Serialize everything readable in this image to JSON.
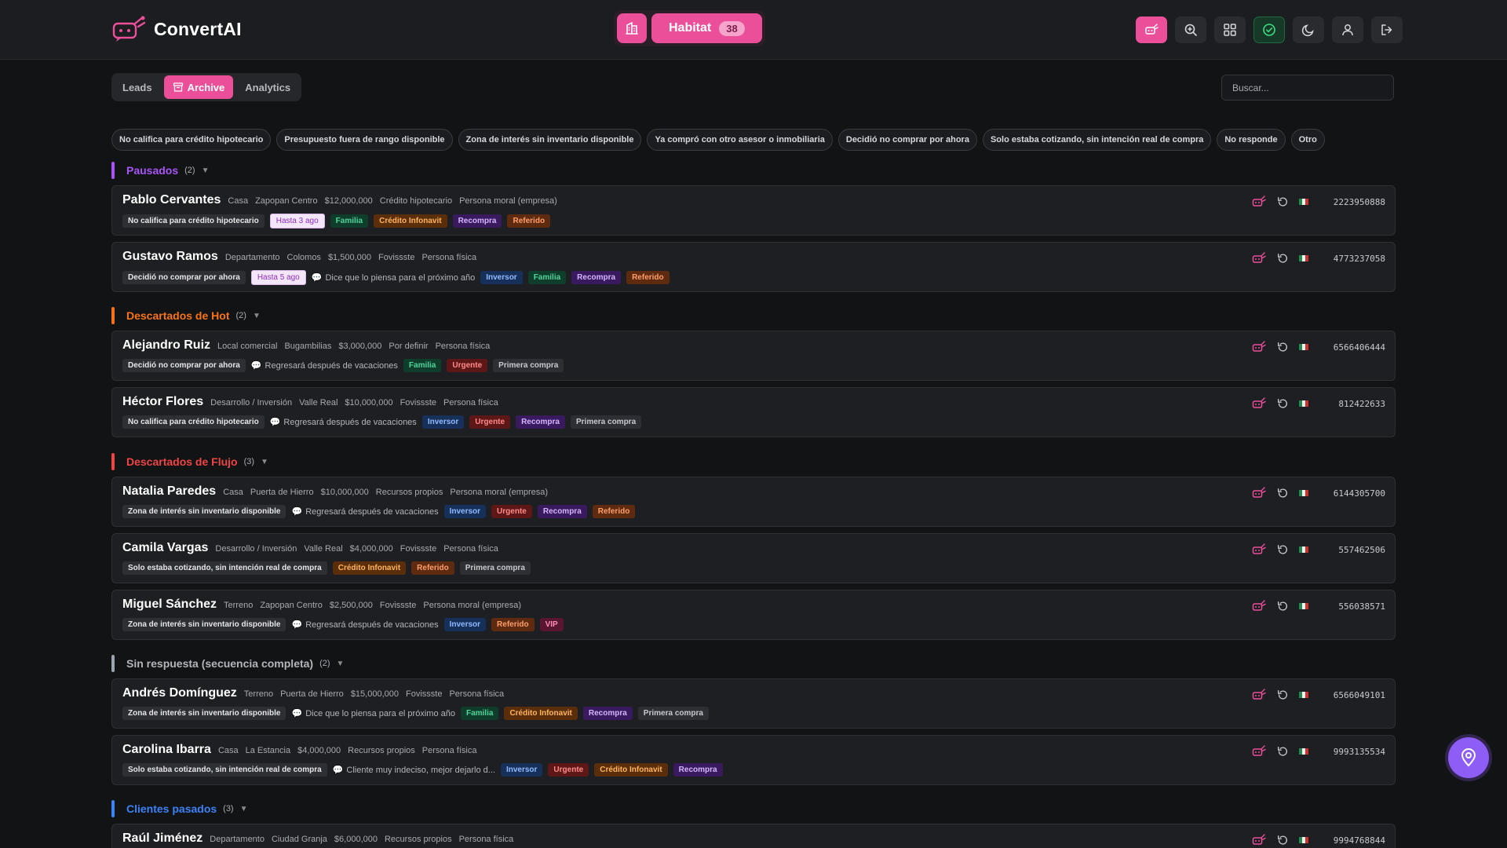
{
  "app": {
    "name": "ConvertAI",
    "hub": {
      "label": "Habitat",
      "count": "38"
    }
  },
  "header_icons": [
    "convertai-bot-icon",
    "zoom-icon",
    "grid-icon",
    "check-circle-icon",
    "moon-icon",
    "user-icon",
    "logout-icon"
  ],
  "tabs": [
    {
      "label": "Leads",
      "active": false
    },
    {
      "label": "Archive",
      "active": true
    },
    {
      "label": "Analytics",
      "active": false
    }
  ],
  "search": {
    "placeholder": "Buscar...",
    "value": ""
  },
  "filters": [
    "No califica para crédito hipotecario",
    "Presupuesto fuera de rango disponible",
    "Zona de interés sin inventario disponible",
    "Ya compró con otro asesor o inmobiliaria",
    "Decidió no comprar por ahora",
    "Solo estaba cotizando, sin intención real de compra",
    "No responde",
    "Otro"
  ],
  "tag_colors": {
    "Familia": {
      "bg": "#0f3d2b",
      "fg": "#4fd49a"
    },
    "Crédito Infonavit": {
      "bg": "#5a2e0a",
      "fg": "#ffb45c"
    },
    "Recompra": {
      "bg": "#3a1a5e",
      "fg": "#d6b3ff"
    },
    "Referido": {
      "bg": "#5e2a10",
      "fg": "#ff9e6b"
    },
    "Inversor": {
      "bg": "#17305a",
      "fg": "#8fbaff"
    },
    "Urgente": {
      "bg": "#5e1717",
      "fg": "#ff8a8a"
    },
    "Primera compra": {
      "bg": "#2e2f34",
      "fg": "#c9cacf"
    },
    "VIP": {
      "bg": "#5a1530",
      "fg": "#ff8fb8"
    }
  },
  "sections": [
    {
      "title": "Pausados",
      "count": "(2)",
      "color": "#a855f7",
      "leads": [
        {
          "name": "Pablo Cervantes",
          "meta": [
            "Casa",
            "Zapopan Centro",
            "$12,000,000",
            "Crédito hipotecario",
            "Persona moral (empresa)"
          ],
          "reason": "No califica para crédito hipotecario",
          "hasta": "Hasta 3 ago",
          "note": "",
          "tags": [
            "Familia",
            "Crédito Infonavit",
            "Recompra",
            "Referido"
          ],
          "phone": "2223950888"
        },
        {
          "name": "Gustavo Ramos",
          "meta": [
            "Departamento",
            "Colomos",
            "$1,500,000",
            "Fovissste",
            "Persona física"
          ],
          "reason": "Decidió no comprar por ahora",
          "hasta": "Hasta 5 ago",
          "note": "Dice que lo piensa para el próximo año",
          "tags": [
            "Inversor",
            "Familia",
            "Recompra",
            "Referido"
          ],
          "phone": "4773237058"
        }
      ]
    },
    {
      "title": "Descartados de Hot",
      "count": "(2)",
      "color": "#f97316",
      "leads": [
        {
          "name": "Alejandro Ruiz",
          "meta": [
            "Local comercial",
            "Bugambilias",
            "$3,000,000",
            "Por definir",
            "Persona física"
          ],
          "reason": "Decidió no comprar por ahora",
          "hasta": "",
          "note": "Regresará después de vacaciones",
          "tags": [
            "Familia",
            "Urgente",
            "Primera compra"
          ],
          "phone": "6566406444"
        },
        {
          "name": "Héctor Flores",
          "meta": [
            "Desarrollo / Inversión",
            "Valle Real",
            "$10,000,000",
            "Fovissste",
            "Persona física"
          ],
          "reason": "No califica para crédito hipotecario",
          "hasta": "",
          "note": "Regresará después de vacaciones",
          "tags": [
            "Inversor",
            "Urgente",
            "Recompra",
            "Primera compra"
          ],
          "phone": "812422633"
        }
      ]
    },
    {
      "title": "Descartados de Flujo",
      "count": "(3)",
      "color": "#ef4444",
      "leads": [
        {
          "name": "Natalia Paredes",
          "meta": [
            "Casa",
            "Puerta de Hierro",
            "$10,000,000",
            "Recursos propios",
            "Persona moral (empresa)"
          ],
          "reason": "Zona de interés sin inventario disponible",
          "hasta": "",
          "note": "Regresará después de vacaciones",
          "tags": [
            "Inversor",
            "Urgente",
            "Recompra",
            "Referido"
          ],
          "phone": "6144305700"
        },
        {
          "name": "Camila Vargas",
          "meta": [
            "Desarrollo / Inversión",
            "Valle Real",
            "$4,000,000",
            "Fovissste",
            "Persona física"
          ],
          "reason": "Solo estaba cotizando, sin intención real de compra",
          "hasta": "",
          "note": "",
          "tags": [
            "Crédito Infonavit",
            "Referido",
            "Primera compra"
          ],
          "phone": "557462506"
        },
        {
          "name": "Miguel Sánchez",
          "meta": [
            "Terreno",
            "Zapopan Centro",
            "$2,500,000",
            "Fovissste",
            "Persona moral (empresa)"
          ],
          "reason": "Zona de interés sin inventario disponible",
          "hasta": "",
          "note": "Regresará después de vacaciones",
          "tags": [
            "Inversor",
            "Referido",
            "VIP"
          ],
          "phone": "556038571"
        }
      ]
    },
    {
      "title": "Sin respuesta (secuencia completa)",
      "count": "(2)",
      "color": "#9ca3af",
      "leads": [
        {
          "name": "Andrés Domínguez",
          "meta": [
            "Terreno",
            "Puerta de Hierro",
            "$15,000,000",
            "Fovissste",
            "Persona física"
          ],
          "reason": "Zona de interés sin inventario disponible",
          "hasta": "",
          "note": "Dice que lo piensa para el próximo año",
          "tags": [
            "Familia",
            "Crédito Infonavit",
            "Recompra",
            "Primera compra"
          ],
          "phone": "6566049101"
        },
        {
          "name": "Carolina Ibarra",
          "meta": [
            "Casa",
            "La Estancia",
            "$4,000,000",
            "Recursos propios",
            "Persona física"
          ],
          "reason": "Solo estaba cotizando, sin intención real de compra",
          "hasta": "",
          "note": "Cliente muy indeciso, mejor dejarlo d...",
          "tags": [
            "Inversor",
            "Urgente",
            "Crédito Infonavit",
            "Recompra"
          ],
          "phone": "9993135534"
        }
      ]
    },
    {
      "title": "Clientes pasados",
      "count": "(3)",
      "color": "#3b82f6",
      "leads": [
        {
          "name": "Raúl Jiménez",
          "meta": [
            "Departamento",
            "Ciudad Granja",
            "$6,000,000",
            "Recursos propios",
            "Persona física"
          ],
          "reason": "",
          "hasta": "",
          "note": "",
          "tags": [],
          "phone": "9994768844"
        }
      ]
    }
  ]
}
